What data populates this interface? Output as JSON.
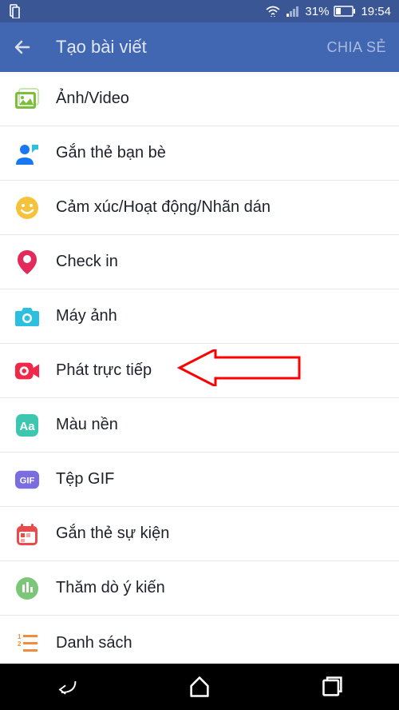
{
  "status": {
    "battery": "31%",
    "time": "19:54"
  },
  "header": {
    "title": "Tạo bài viết",
    "share": "CHIA SẺ"
  },
  "items": [
    {
      "label": "Ảnh/Video",
      "icon": "photo",
      "color": "#7bbf3a"
    },
    {
      "label": "Gắn thẻ bạn bè",
      "icon": "tag-friend",
      "color": "#1877f2"
    },
    {
      "label": "Cảm xúc/Hoạt động/Nhãn dán",
      "icon": "feeling",
      "color": "#f5c33b"
    },
    {
      "label": "Check in",
      "icon": "checkin",
      "color": "#e42a5b"
    },
    {
      "label": "Máy ảnh",
      "icon": "camera",
      "color": "#2bbfe0"
    },
    {
      "label": "Phát trực tiếp",
      "icon": "live",
      "color": "#f12849"
    },
    {
      "label": "Màu nền",
      "icon": "background",
      "color": "#3ec7b0"
    },
    {
      "label": "Tệp GIF",
      "icon": "gif",
      "color": "#4ab8a1"
    },
    {
      "label": "Gắn thẻ sự kiện",
      "icon": "event",
      "color": "#e94b4b"
    },
    {
      "label": "Thăm dò ý kiến",
      "icon": "poll",
      "color": "#7cc67a"
    },
    {
      "label": "Danh sách",
      "icon": "list",
      "color": "#f28c3a"
    }
  ]
}
